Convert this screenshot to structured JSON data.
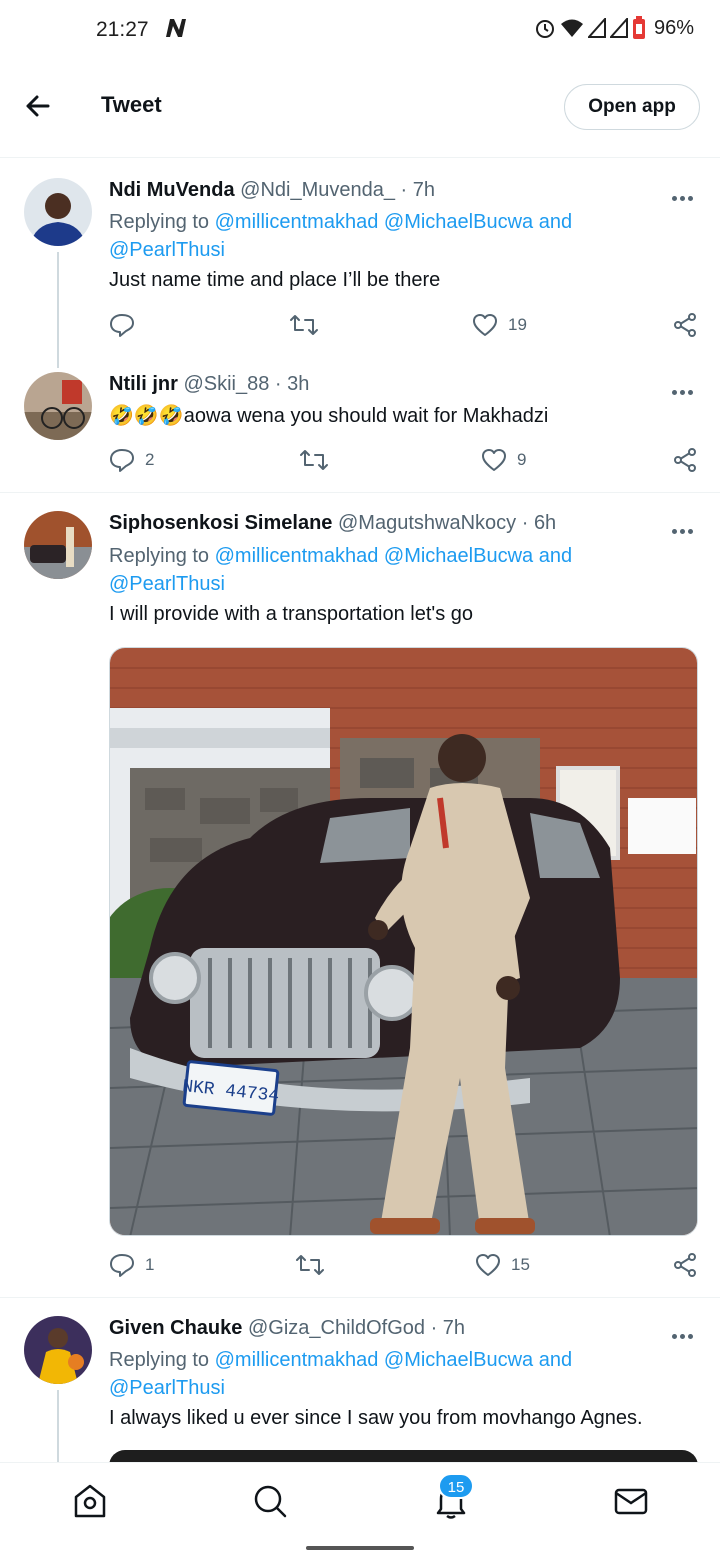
{
  "status_bar": {
    "time": "21:27",
    "battery": "96%"
  },
  "header": {
    "title": "Tweet",
    "open_app": "Open app"
  },
  "tweets": [
    {
      "name": "Ndi MuVenda",
      "handle": "@Ndi_Muvenda_",
      "time": "7h",
      "replying_prefix": "Replying to",
      "mentions": [
        "@millicentmakhad",
        "@MichaelBucwa",
        "@PearlThusi"
      ],
      "and_word": "and",
      "text": "Just name time and place I’ll be there",
      "replies": "",
      "retweets": "",
      "likes": "19"
    },
    {
      "name": "Ntili jnr",
      "handle": "@Skii_88",
      "time": "3h",
      "text": "🤣🤣🤣aowa wena you should wait for Makhadzi",
      "replies": "2",
      "retweets": "",
      "likes": "9"
    },
    {
      "name": "Siphosenkosi Simelane",
      "handle": "@MagutshwaNkocy",
      "time": "6h",
      "replying_prefix": "Replying to",
      "mentions": [
        "@millicentmakhad",
        "@MichaelBucwa",
        "@PearlThusi"
      ],
      "and_word": "and",
      "text": "I will provide with a transportation let's go",
      "media_plate": "NKR 44734",
      "replies": "1",
      "retweets": "",
      "likes": "15"
    },
    {
      "name": "Given Chauke",
      "handle": "@Giza_ChildOfGod",
      "time": "7h",
      "replying_prefix": "Replying to",
      "mentions": [
        "@millicentmakhad",
        "@MichaelBucwa",
        "@PearlThusi"
      ],
      "and_word": "and",
      "text": "I always liked u ever since I saw you from movhango Agnes."
    }
  ],
  "nav": {
    "notifications_badge": "15"
  },
  "colors": {
    "accent": "#1d9bf0",
    "text": "#0f1419",
    "muted": "#536471",
    "border": "#eff3f4"
  }
}
